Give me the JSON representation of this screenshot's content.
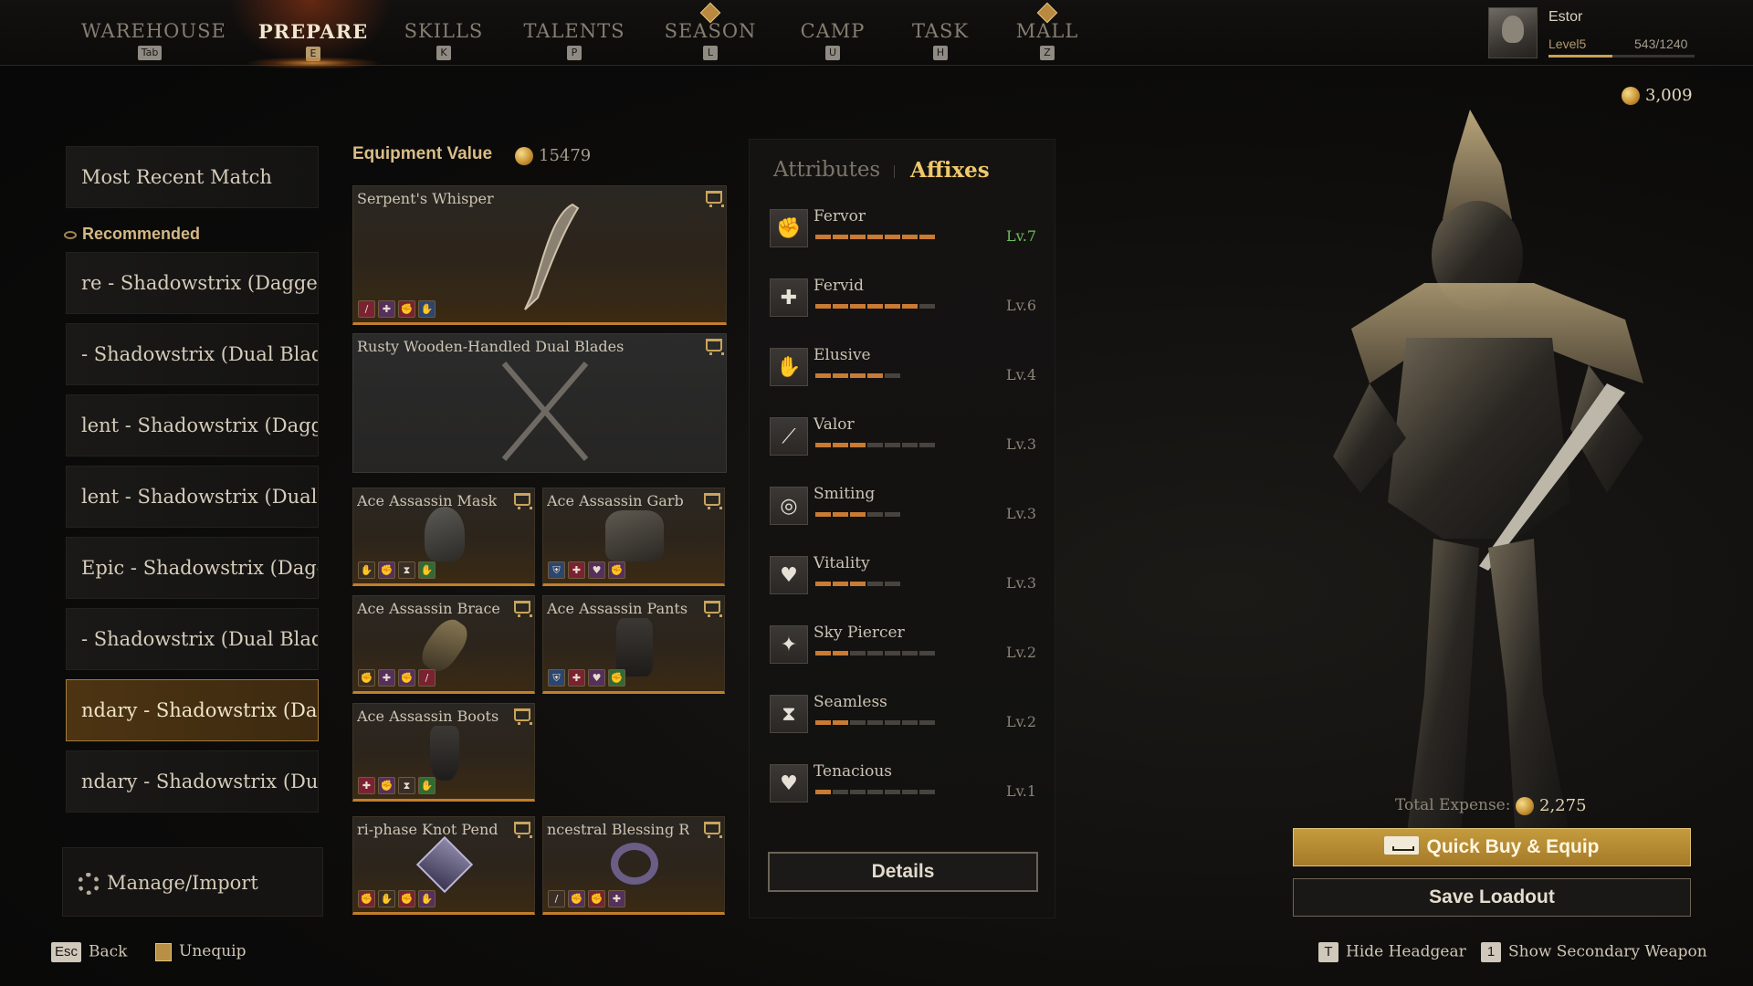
{
  "nav": {
    "items": [
      {
        "label": "WAREHOUSE",
        "key": "Tab"
      },
      {
        "label": "PREPARE",
        "key": "E"
      },
      {
        "label": "SKILLS",
        "key": "K"
      },
      {
        "label": "TALENTS",
        "key": "P"
      },
      {
        "label": "SEASON",
        "key": "L"
      },
      {
        "label": "CAMP",
        "key": "U"
      },
      {
        "label": "TASK",
        "key": "H"
      },
      {
        "label": "MALL",
        "key": "Z"
      }
    ],
    "active": "PREPARE"
  },
  "profile": {
    "name": "Estor",
    "level": "Level5",
    "xp": "543/1240",
    "xp_fraction": 0.44
  },
  "currency": "3,009",
  "loadouts": {
    "most_recent": "Most Recent Match",
    "recommended_header": "Recommended",
    "items": [
      "re - Shadowstrix (Dagger)",
      "- Shadowstrix (Dual Blade",
      "lent - Shadowstrix (Dagge",
      "lent - Shadowstrix (Dual I",
      "Epic - Shadowstrix (Dagg",
      "- Shadowstrix (Dual Blade",
      "ndary - Shadowstrix (Dag",
      "ndary - Shadowstrix (Dua"
    ],
    "selected_index": 6,
    "manage_label": "Manage/Import"
  },
  "equipment": {
    "header": "Equipment Value",
    "value": "15479",
    "slots": [
      {
        "name": "Serpent's Whisper"
      },
      {
        "name": "Rusty Wooden-Handled Dual Blades"
      },
      {
        "name": "Ace Assassin Mask"
      },
      {
        "name": "Ace Assassin Garb"
      },
      {
        "name": "Ace Assassin Brace"
      },
      {
        "name": "Ace Assassin Pants"
      },
      {
        "name": "Ace Assassin Boots"
      },
      {
        "name": "ri-phase Knot Pend"
      },
      {
        "name": "ncestral Blessing R"
      }
    ]
  },
  "affix_panel": {
    "tab_attributes": "Attributes",
    "tab_affixes": "Affixes",
    "details_label": "Details",
    "affixes": [
      {
        "name": "Fervor",
        "level": "Lv.7",
        "filled": 7,
        "max": 7
      },
      {
        "name": "Fervid",
        "level": "Lv.6",
        "filled": 6,
        "max": 7
      },
      {
        "name": "Elusive",
        "level": "Lv.4",
        "filled": 4,
        "max": 5
      },
      {
        "name": "Valor",
        "level": "Lv.3",
        "filled": 3,
        "max": 7
      },
      {
        "name": "Smiting",
        "level": "Lv.3",
        "filled": 3,
        "max": 5
      },
      {
        "name": "Vitality",
        "level": "Lv.3",
        "filled": 3,
        "max": 5
      },
      {
        "name": "Sky Piercer",
        "level": "Lv.2",
        "filled": 2,
        "max": 7
      },
      {
        "name": "Seamless",
        "level": "Lv.2",
        "filled": 2,
        "max": 7
      },
      {
        "name": "Tenacious",
        "level": "Lv.1",
        "filled": 1,
        "max": 7
      }
    ]
  },
  "purchase": {
    "total_label": "Total Expense:",
    "total_value": "2,275",
    "quick_buy": "Quick Buy & Equip",
    "save_loadout": "Save Loadout"
  },
  "footer": {
    "esc_key": "Esc",
    "back": "Back",
    "unequip": "Unequip",
    "t_key": "T",
    "hide_headgear": "Hide Headgear",
    "one_key": "1",
    "show_secondary": "Show Secondary Weapon"
  }
}
